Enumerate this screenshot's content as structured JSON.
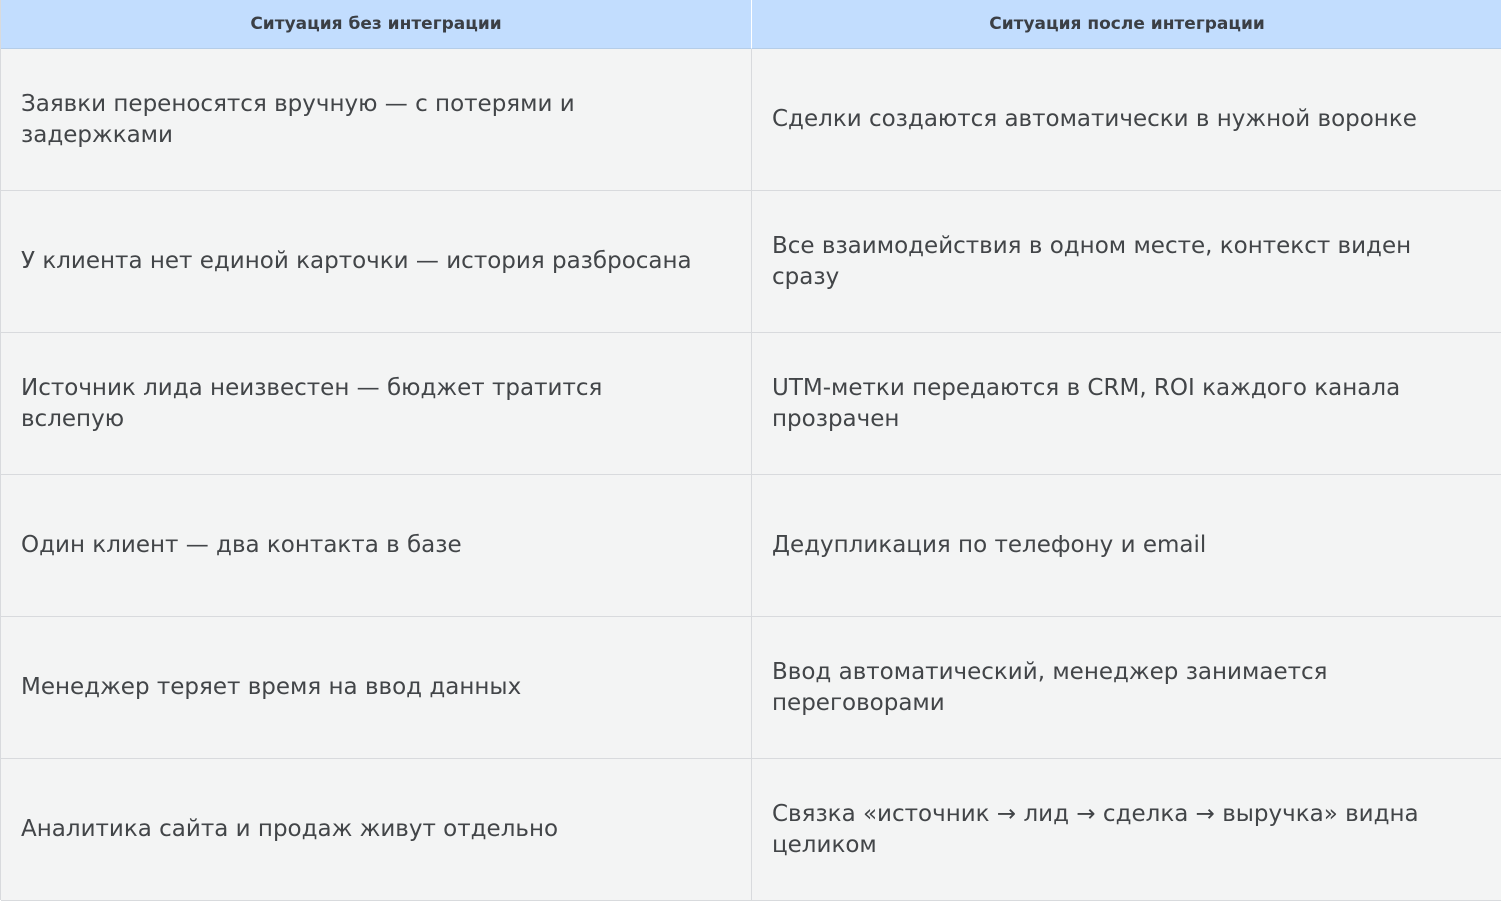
{
  "table": {
    "headers": [
      "Ситуация без интеграции",
      "Ситуация после интеграции"
    ],
    "rows": [
      [
        "Заявки переносятся вручную — с потерями и задержками",
        "Сделки создаются автоматически в нужной воронке"
      ],
      [
        "У клиента нет единой карточки — история разбросана",
        "Все взаимодействия в одном месте, контекст виден сразу"
      ],
      [
        "Источник лида неизвестен — бюджет тратится вслепую",
        "UTM-метки передаются в CRM, ROI каждого канала прозрачен"
      ],
      [
        "Один клиент — два контакта в базе",
        "Дедупликация по телефону и email"
      ],
      [
        "Менеджер теряет время на ввод данных",
        "Ввод автоматический, менеджер занимается переговорами"
      ],
      [
        "Аналитика сайта и продаж живут отдельно",
        "Связка «источник → лид → сделка → выручка» видна целиком"
      ]
    ]
  },
  "colors": {
    "header_bg": "#c2ddfe",
    "cell_bg": "#f3f4f4",
    "border": "#d8dadd",
    "text": "#424548"
  }
}
